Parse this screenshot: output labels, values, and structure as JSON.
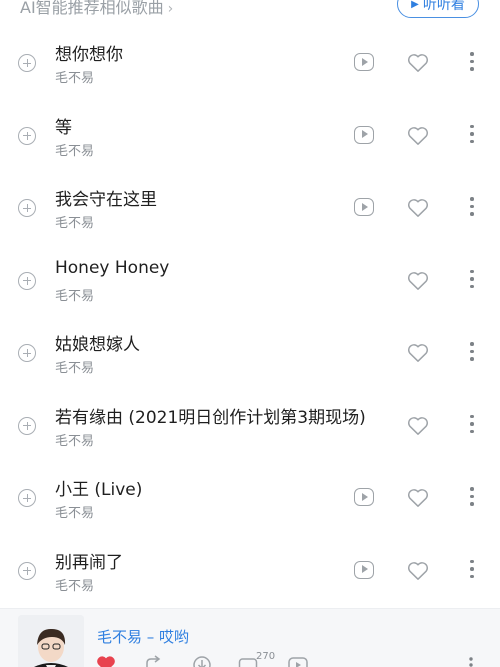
{
  "header": {
    "section_title": "AI智能推荐相似歌曲",
    "listen_button": "听听看"
  },
  "songs": [
    {
      "title": "想你想你",
      "artist": "毛不易",
      "has_mv": true
    },
    {
      "title": "等",
      "artist": "毛不易",
      "has_mv": true
    },
    {
      "title": "我会守在这里",
      "artist": "毛不易",
      "has_mv": true
    },
    {
      "title": "Honey Honey",
      "artist": "毛不易",
      "has_mv": false
    },
    {
      "title": "姑娘想嫁人",
      "artist": "毛不易",
      "has_mv": false
    },
    {
      "title": "若有缘由 (2021明日创作计划第3期现场)",
      "artist": "毛不易",
      "has_mv": false
    },
    {
      "title": "小王 (Live)",
      "artist": "毛不易",
      "has_mv": true
    },
    {
      "title": "别再闹了",
      "artist": "毛不易",
      "has_mv": true
    }
  ],
  "player": {
    "now_playing": "毛不易 – 哎哟",
    "comment_count": "270",
    "liked": true
  },
  "colors": {
    "accent": "#2f7fe0",
    "liked_heart": "#e8434f",
    "icon_gray": "#9ea3a8"
  }
}
